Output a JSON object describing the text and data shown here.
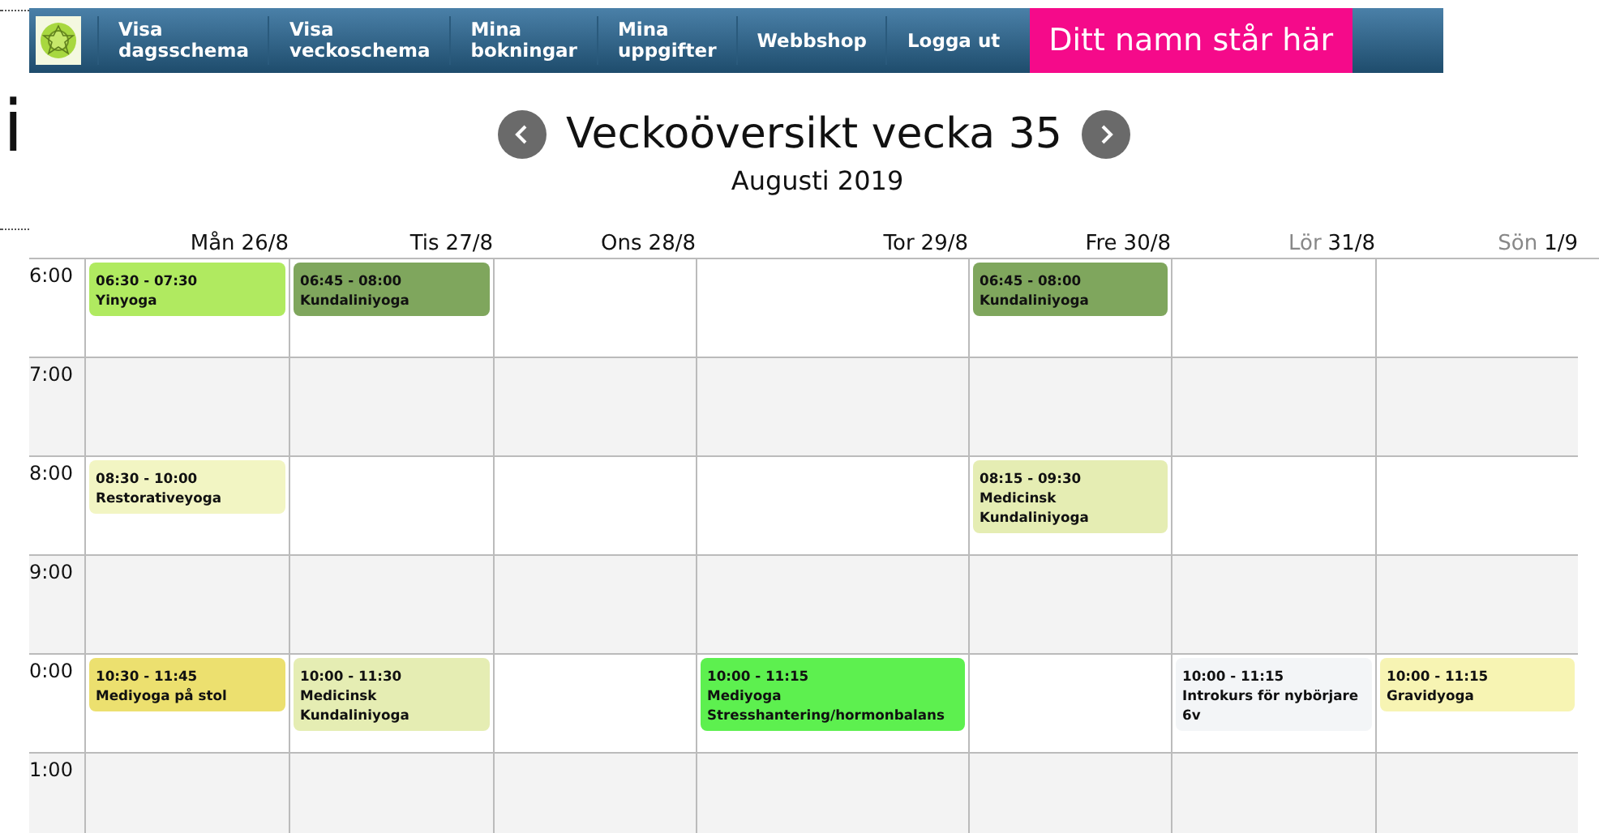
{
  "nav": {
    "items": [
      {
        "label": "Visa\ndagsschema"
      },
      {
        "label": "Visa\nveckoschema"
      },
      {
        "label": "Mina\nbokningar"
      },
      {
        "label": "Mina\nuppgifter"
      },
      {
        "label": "Webbshop"
      },
      {
        "label": "Logga ut"
      }
    ],
    "user_name": "Ditt namn står här"
  },
  "side_fragment": "i",
  "title": "Veckoöversikt vecka 35",
  "subtitle": "Augusti 2019",
  "days": [
    {
      "name": "Mån",
      "date": "26/8",
      "weekend": false
    },
    {
      "name": "Tis",
      "date": "27/8",
      "weekend": false
    },
    {
      "name": "Ons",
      "date": "28/8",
      "weekend": false
    },
    {
      "name": "Tor",
      "date": "29/8",
      "weekend": false
    },
    {
      "name": "Fre",
      "date": "30/8",
      "weekend": false
    },
    {
      "name": "Lör",
      "date": "31/8",
      "weekend": true
    },
    {
      "name": "Sön",
      "date": "1/9",
      "weekend": true
    }
  ],
  "rows": [
    {
      "hour": "6:00",
      "cells": [
        {
          "time": "06:30 - 07:30",
          "lines": [
            "Yinyoga"
          ],
          "color": "#b0ea60"
        },
        {
          "time": "06:45 - 08:00",
          "lines": [
            "Kundaliniyoga"
          ],
          "color": "#7fa65d"
        },
        null,
        null,
        {
          "time": "06:45 - 08:00",
          "lines": [
            "Kundaliniyoga"
          ],
          "color": "#7fa65d"
        },
        null,
        null
      ]
    },
    {
      "hour": "7:00",
      "cells": [
        null,
        null,
        null,
        null,
        null,
        null,
        null
      ]
    },
    {
      "hour": "8:00",
      "cells": [
        {
          "time": "08:30 - 10:00",
          "lines": [
            "Restorativeyoga"
          ],
          "color": "#f2f5c3"
        },
        null,
        null,
        null,
        {
          "time": "08:15 - 09:30",
          "lines": [
            "Medicinsk",
            "Kundaliniyoga"
          ],
          "color": "#e5edb3"
        },
        null,
        null
      ]
    },
    {
      "hour": "9:00",
      "cells": [
        null,
        null,
        null,
        null,
        null,
        null,
        null
      ]
    },
    {
      "hour": "0:00",
      "cells": [
        {
          "time": "10:30 - 11:45",
          "lines": [
            "Mediyoga på stol"
          ],
          "color": "#ece06f"
        },
        {
          "time": "10:00 - 11:30",
          "lines": [
            "Medicinsk",
            "Kundaliniyoga"
          ],
          "color": "#e5edb3"
        },
        null,
        {
          "time": "10:00 - 11:15",
          "lines": [
            "Mediyoga",
            "Stresshantering/hormonbalans"
          ],
          "color": "#5df04f"
        },
        null,
        {
          "time": "10:00 - 11:15",
          "lines": [
            "Introkurs för nybörjare",
            "6v"
          ],
          "color": "#f3f5f7"
        },
        {
          "time": "10:00 - 11:15",
          "lines": [
            "Gravidyoga"
          ],
          "color": "#f7f4b3"
        }
      ]
    },
    {
      "hour": "1:00",
      "cells": [
        null,
        null,
        null,
        null,
        null,
        null,
        null
      ]
    }
  ]
}
